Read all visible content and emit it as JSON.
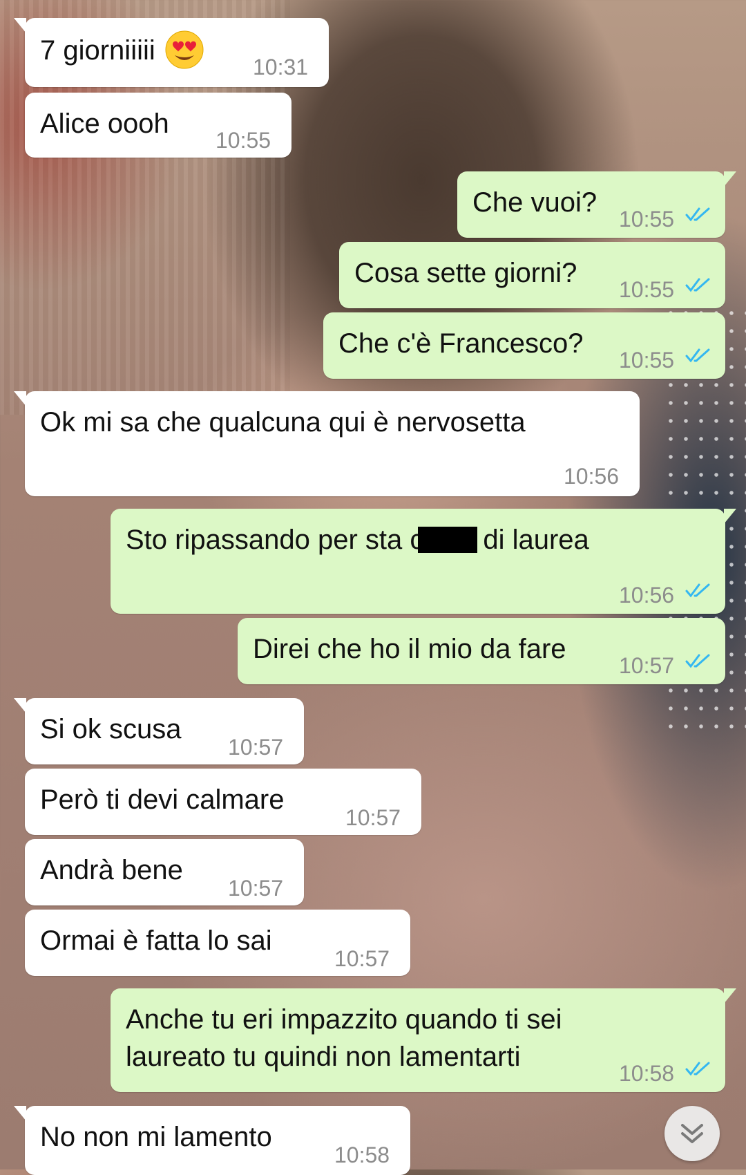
{
  "chat": {
    "messages": [
      {
        "dir": "in",
        "text": "7 giorniiiii",
        "time": "10:31",
        "emoji": "heart-eyes"
      },
      {
        "dir": "in",
        "text": "Alice oooh",
        "time": "10:55"
      },
      {
        "dir": "out",
        "text": "Che vuoi?",
        "time": "10:55",
        "status": "read"
      },
      {
        "dir": "out",
        "text": "Cosa sette giorni?",
        "time": "10:55",
        "status": "read"
      },
      {
        "dir": "out",
        "text": "Che c'è Francesco?",
        "time": "10:55",
        "status": "read"
      },
      {
        "dir": "in",
        "text": "Ok mi sa che qualcuna qui è nervosetta",
        "time": "10:56"
      },
      {
        "dir": "out",
        "text_before": "Sto ripassando per sta c",
        "text_after": "di laurea",
        "time": "10:56",
        "status": "read"
      },
      {
        "dir": "out",
        "text": "Direi che ho il mio da fare",
        "time": "10:57",
        "status": "read"
      },
      {
        "dir": "in",
        "text": "Si ok scusa",
        "time": "10:57"
      },
      {
        "dir": "in",
        "text": "Però ti devi calmare",
        "time": "10:57"
      },
      {
        "dir": "in",
        "text": "Andrà bene",
        "time": "10:57"
      },
      {
        "dir": "in",
        "text": "Ormai è fatta lo sai",
        "time": "10:57"
      },
      {
        "dir": "out",
        "line1": "Anche tu eri impazzito quando ti sei",
        "line2": "laureato tu quindi non lamentarti",
        "time": "10:58",
        "status": "read"
      },
      {
        "dir": "in",
        "text": "No non mi lamento",
        "time": "10:58"
      }
    ]
  },
  "colors": {
    "incoming_bubble": "#ffffff",
    "outgoing_bubble": "#dcf8c6",
    "read_ticks": "#34b7f1",
    "timestamp": "#8c8c8c"
  },
  "icons": {
    "read_status": "double-check-icon",
    "scroll_button": "chevron-double-down-icon",
    "emoji": "heart-eyes-emoji-icon"
  }
}
